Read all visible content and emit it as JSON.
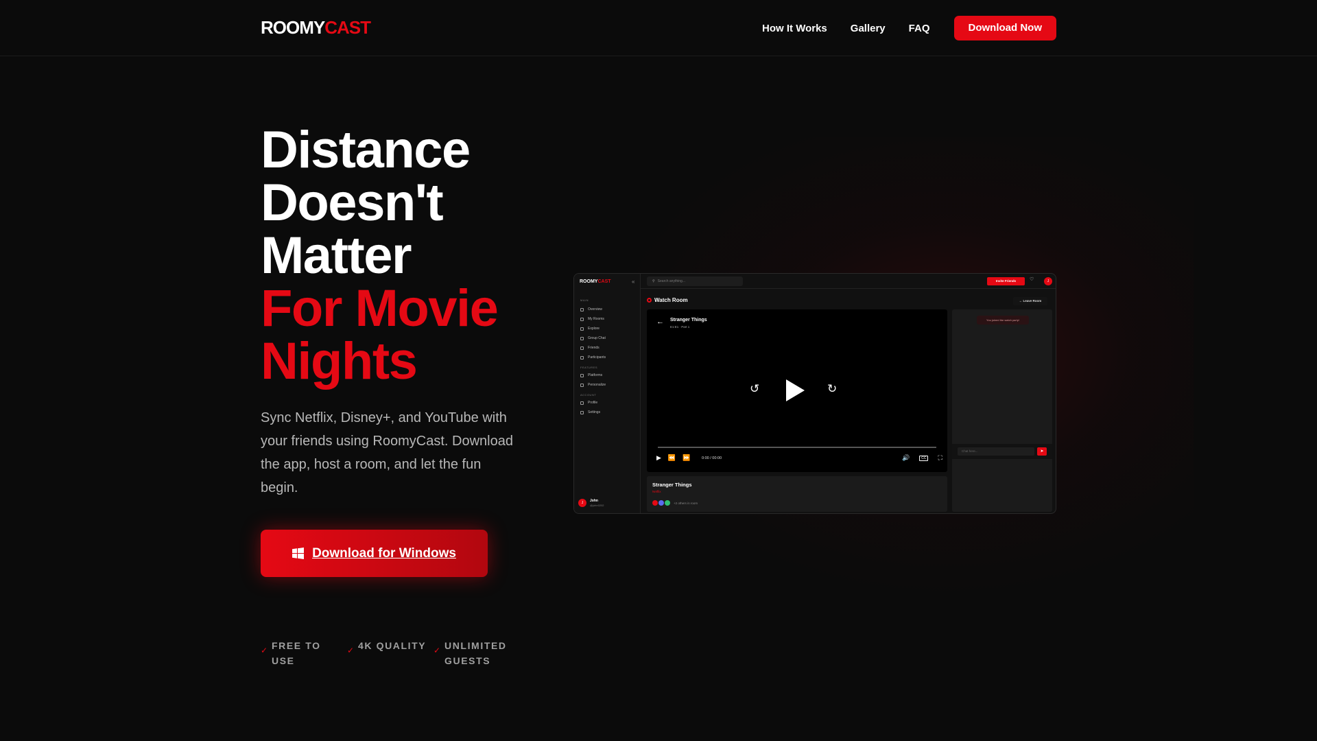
{
  "brand": {
    "part1": "ROOMY",
    "part2": "CAST",
    "accent_color": "#e50914"
  },
  "nav": {
    "items": [
      "How It Works",
      "Gallery",
      "FAQ"
    ],
    "cta": "Download Now"
  },
  "hero": {
    "title_white": [
      "Distance",
      "Doesn't",
      "Matter"
    ],
    "title_red": [
      "For Movie",
      "Nights"
    ],
    "description": "Sync Netflix, Disney+, and YouTube with your friends using RoomyCast. Download the app, host a room, and let the fun begin.",
    "download_button": "Download for Windows",
    "download_icon": "windows-icon",
    "features": [
      "FREE TO USE",
      "4K QUALITY",
      "UNLIMITED GUESTS"
    ]
  },
  "mock_app": {
    "logo": {
      "part1": "ROOMY",
      "part2": "CAST"
    },
    "sections": {
      "main": "MAIN",
      "features": "FEATURES",
      "account": "ACCOUNT"
    },
    "main_items": [
      "Overview",
      "My Rooms",
      "Explore",
      "Group Chat",
      "Friends",
      "Participants"
    ],
    "feature_items": [
      "Platforms",
      "Personalize"
    ],
    "account_items": [
      "Profile",
      "Settings"
    ],
    "user": {
      "initial": "J",
      "name": "John",
      "handle": "@john0202"
    },
    "search_placeholder": "Search anything...",
    "invite_button": "Invite Friends",
    "room_title": "Watch Room",
    "leave_button": "Leave Room",
    "player": {
      "title": "Stranger Things",
      "subtitle": "E1:E1 · Part 1",
      "time": "0:00 / 00:00",
      "cc": "CC"
    },
    "info": {
      "title": "Stranger Things",
      "platform": "Netflix",
      "others": "+2 others in room"
    },
    "chat": {
      "joined": "You joined the watch party!",
      "placeholder": "Chat here..."
    }
  }
}
